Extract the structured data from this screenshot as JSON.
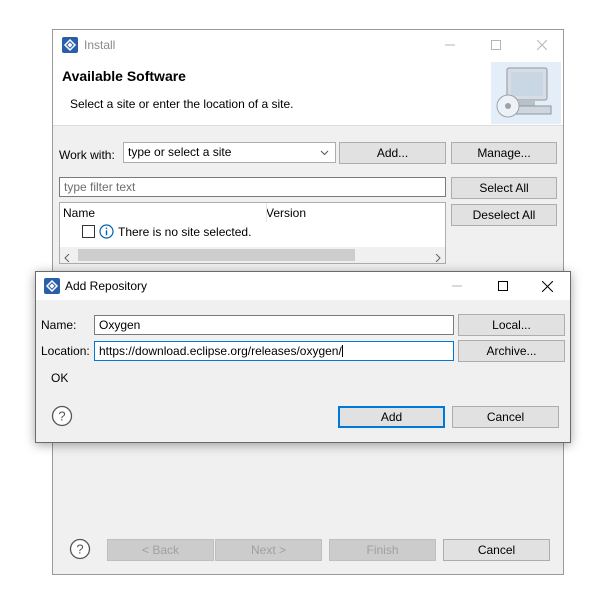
{
  "install": {
    "title": "Install",
    "header_title": "Available Software",
    "header_subtitle": "Select a site or enter the location of a site.",
    "work_with_label": "Work with:",
    "work_with_value": "type or select a site",
    "add_label": "Add...",
    "manage_label": "Manage...",
    "filter_placeholder": "type filter text",
    "select_all_label": "Select All",
    "deselect_all_label": "Deselect All",
    "columns": [
      "Name",
      "Version"
    ],
    "list_message": "There is no site selected.",
    "back_label": "< Back",
    "next_label": "Next >",
    "finish_label": "Finish",
    "cancel_label": "Cancel"
  },
  "dialog": {
    "title": "Add Repository",
    "name_label": "Name:",
    "name_value": "Oxygen",
    "location_label": "Location:",
    "location_value": "https://download.eclipse.org/releases/oxygen/",
    "local_label": "Local...",
    "archive_label": "Archive...",
    "status": "OK",
    "add_label": "Add",
    "cancel_label": "Cancel"
  },
  "icons": {
    "help": "help-icon",
    "info": "info-icon",
    "app": "eclipse-icon",
    "header_graphic": "monitor-cd-icon"
  },
  "colors": {
    "accent": "#0078d7",
    "app_icon": "#2b5ea8"
  }
}
